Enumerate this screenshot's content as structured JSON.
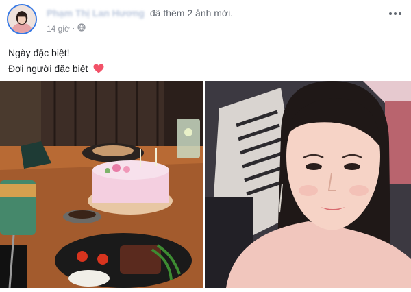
{
  "post": {
    "author_name": "Phạm Thị Lan Hương",
    "action_text": "đã thêm 2 ảnh mới.",
    "timestamp": "14 giờ",
    "separator": "·",
    "privacy_icon": "globe-icon",
    "more_icon": "more-options-icon",
    "caption_lines": [
      "Ngày đặc biệt!",
      "Đợi người đặc biệt"
    ],
    "caption_emoji": "heart-icon",
    "photos": [
      {
        "label": "photo-birthday-dinner"
      },
      {
        "label": "photo-selfie"
      }
    ]
  },
  "colors": {
    "avatar_ring": "#3578e5",
    "author_blurred": "#b9c6dc",
    "meta_text": "#90949c",
    "heart": "#f25268"
  }
}
